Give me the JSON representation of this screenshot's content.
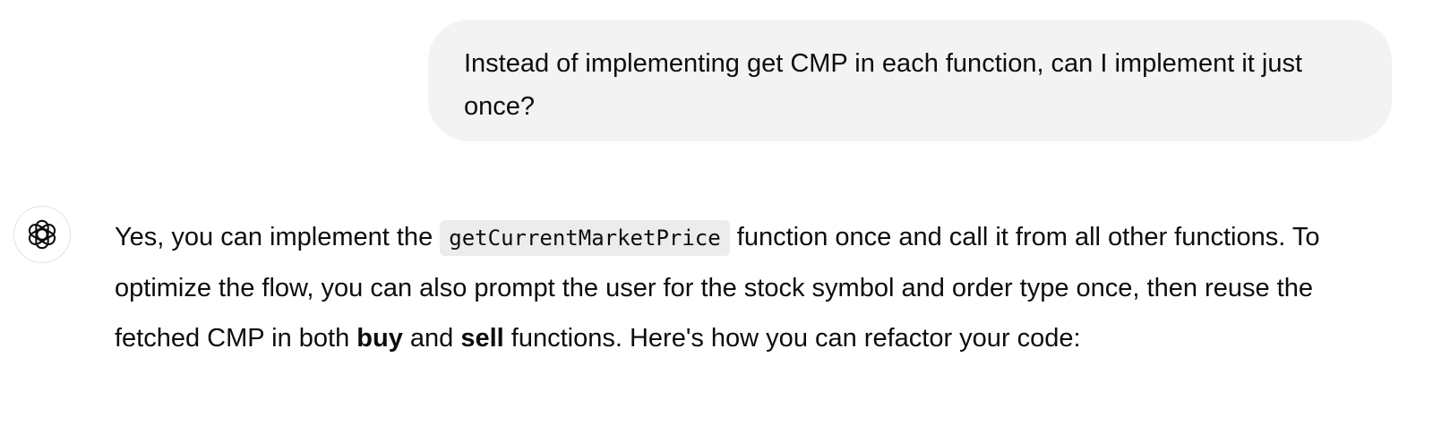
{
  "user_message": {
    "text": "Instead of implementing get CMP in each function, can I implement it just once?"
  },
  "assistant_avatar": {
    "icon": "openai-logo-icon"
  },
  "assistant_message": {
    "part1": "Yes, you can implement the ",
    "code1": "getCurrentMarketPrice",
    "part2": " function once and call it from all other functions. To optimize the flow, you can also prompt the user for the stock symbol and order type once, then reuse the fetched CMP in both ",
    "bold1": "buy",
    "part3": " and ",
    "bold2": "sell",
    "part4": " functions. Here's how you can refactor your code:"
  }
}
